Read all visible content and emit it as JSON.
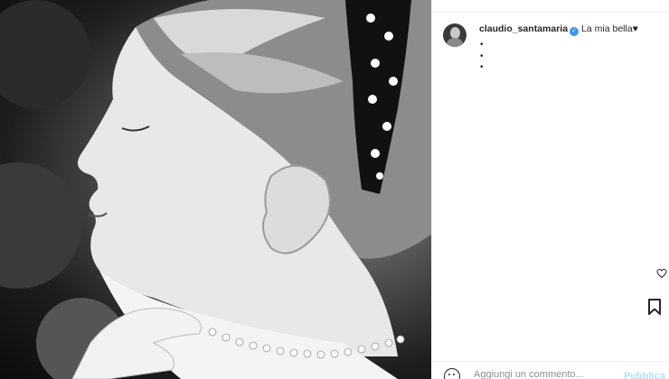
{
  "post": {
    "username": "claudio_santamaria",
    "verified_icon": "verified-badge-icon",
    "caption": "La mia bella♥",
    "caption_dots": [
      "•",
      "•",
      "•"
    ]
  },
  "comment": {
    "placeholder": "Aggiungi un commento...",
    "publish_label": "Pubblica"
  },
  "icons": {
    "avatar": "avatar",
    "like": "heart-icon",
    "save": "bookmark-icon",
    "emoji": "emoji-icon"
  },
  "colors": {
    "verified": "#3897f0",
    "publish_disabled": "#b2dffc",
    "text": "#262626",
    "muted": "#8e8e8e"
  }
}
